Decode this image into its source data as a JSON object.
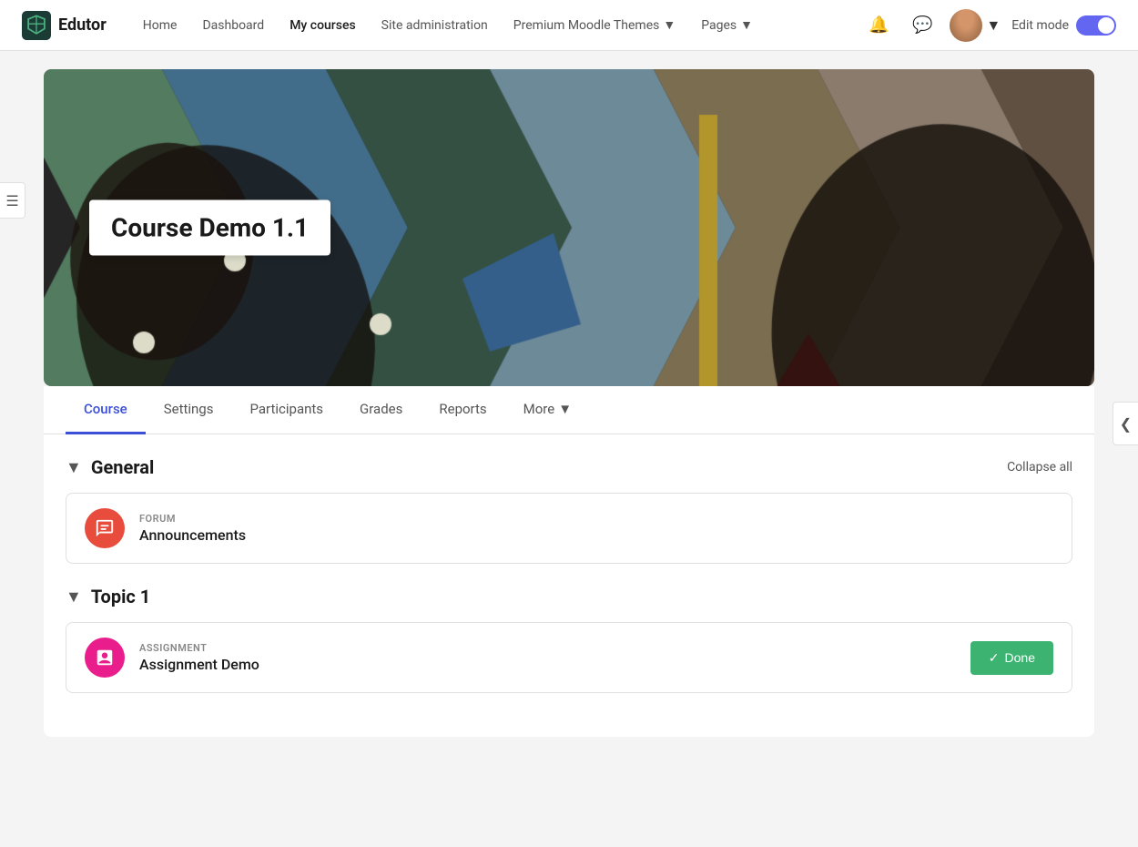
{
  "brand": {
    "name": "Edutor",
    "logo_alt": "Edutor logo"
  },
  "navbar": {
    "links": [
      {
        "label": "Home",
        "active": false
      },
      {
        "label": "Dashboard",
        "active": false
      },
      {
        "label": "My courses",
        "active": true
      },
      {
        "label": "Site administration",
        "active": false
      },
      {
        "label": "Premium Moodle Themes",
        "active": false,
        "has_dropdown": true
      },
      {
        "label": "Pages",
        "active": false,
        "has_dropdown": true
      }
    ],
    "edit_mode_label": "Edit mode"
  },
  "hero": {
    "course_title": "Course Demo 1.1"
  },
  "tabs": [
    {
      "label": "Course",
      "active": true
    },
    {
      "label": "Settings",
      "active": false
    },
    {
      "label": "Participants",
      "active": false
    },
    {
      "label": "Grades",
      "active": false
    },
    {
      "label": "Reports",
      "active": false
    },
    {
      "label": "More",
      "active": false,
      "has_dropdown": true
    }
  ],
  "sections": [
    {
      "id": "general",
      "title": "General",
      "collapsed": false,
      "activities": [
        {
          "type": "FORUM",
          "name": "Announcements",
          "icon_type": "forum"
        }
      ]
    },
    {
      "id": "topic1",
      "title": "Topic 1",
      "collapsed": false,
      "activities": [
        {
          "type": "ASSIGNMENT",
          "name": "Assignment Demo",
          "icon_type": "assignment",
          "has_done": true,
          "done_label": "Done"
        }
      ]
    }
  ],
  "actions": {
    "collapse_all": "Collapse all"
  },
  "icons": {
    "chevron_down": "▼",
    "chevron_right": "❯",
    "chevron_left": "❮",
    "checkmark": "✓",
    "bell": "🔔",
    "chat": "💬",
    "list": "☰"
  }
}
